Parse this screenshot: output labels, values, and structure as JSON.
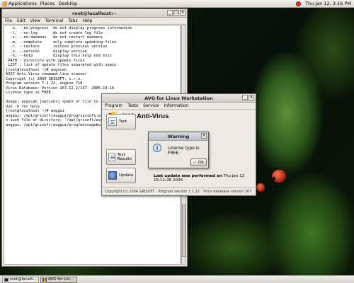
{
  "top_panel": {
    "menus": [
      "Applications",
      "Places",
      "Desktop"
    ],
    "clock": "Thu Jan 12,  3:16 PM"
  },
  "taskbar": {
    "items": [
      {
        "label": "root@localh..."
      },
      {
        "label": "AVG for Lin..."
      }
    ]
  },
  "terminal": {
    "title": "root@localhost:~",
    "menu": [
      "File",
      "Edit",
      "View",
      "Terminal",
      "Tabs",
      "Help"
    ],
    "lines": [
      "  -n, --no-progress  do not display progress information",
      "  -l, --no-log       do not create log file",
      "  -s, --no-daemons   do not restart daemons",
      "  -m, --complete     only complete updating files",
      "  -r, --restore      restore previous version",
      "  -v, --version      display version",
      "  -h, --help         display this help end exit",
      " PATH : directory with update files",
      " LIST : list of update files separated with space",
      "[root@localhost ~]# avgscan",
      "AVG7 Anti-Virus command line scanner",
      "Copyright (c) 2005 GRISOFT, s.r.o.",
      "Program version 7.1.22, engine 718",
      "Virus Database: Version 267.12.2/137  2005-10-16",
      "License type is FREE.",
      "",
      "Usage: avgscan [options] <path or file to s",
      "Use -h for help",
      "[root@localhost ~]# avggui",
      "avggui: /opt/grisoft/avggui/prog/sysinfo.py",
      "n such file or directory: '/opt/grisoft/avgg",
      "avggui: /opt/grisoft/avggui/prog/messagebox."
    ]
  },
  "avg": {
    "title": "AVG for Linux Workstation",
    "menu": [
      "Program",
      "Tests",
      "Service",
      "Information"
    ],
    "brand": "AVG Anti-Virus",
    "buttons": {
      "test": "Test",
      "results": "Test Results",
      "update": "Update"
    },
    "last_update_label": "Last update was performed on",
    "last_update_value": "Thu Jan 12 15:12:26 2006",
    "status": {
      "copyright": "Copyright (c) 2004 GRISOFT",
      "program_version": "Program version 7.1.22",
      "virus_db": "Virus database version 267."
    }
  },
  "warning": {
    "title": "Warning",
    "message": "License type is FREE.",
    "ok_label": "OK"
  },
  "colors": {
    "avg_red": "#d6001c",
    "avg_yellow": "#f3d100",
    "avg_blue": "#1f4fb6",
    "panel_bg": "#e6e3de"
  }
}
